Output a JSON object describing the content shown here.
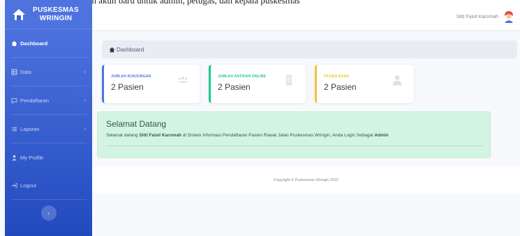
{
  "caption": "mlah akun baru untuk admin, petugas, dan kepala puskesmas",
  "sidebar": {
    "brand_line1": "PUSKESMAS",
    "brand_line2": "WRINGIN",
    "items": [
      {
        "label": "Dashboard",
        "icon": "home-icon",
        "active": true
      },
      {
        "label": "Data",
        "icon": "table-icon",
        "has_submenu": true
      },
      {
        "label": "Pendaftaran",
        "icon": "comment-icon",
        "has_submenu": true
      },
      {
        "label": "Laporan",
        "icon": "list-icon",
        "has_submenu": true
      },
      {
        "label": "My Profile",
        "icon": "user-icon"
      },
      {
        "label": "Logout",
        "icon": "logout-icon"
      }
    ],
    "toggle_glyph": "‹"
  },
  "topbar": {
    "user_name": "Sitti Faisil Karomah"
  },
  "breadcrumb": {
    "label": "Dashboard"
  },
  "cards": [
    {
      "label": "JUMLAH KUNJUNGAN",
      "value": "2 Pasien",
      "icon": "users-icon",
      "accent": "#4e73df"
    },
    {
      "label": "JUMLAH ANTRIAN ONLINE",
      "value": "2 Pasien",
      "icon": "mobile-icon",
      "accent": "#1cc88a"
    },
    {
      "label": "PASIEN BARU",
      "value": "2 Pasien",
      "icon": "user-icon",
      "accent": "#f6c23e"
    }
  ],
  "welcome": {
    "title": "Selamat Datang",
    "prefix": "Selamat datang ",
    "user": "Sitti Faisil Karomah",
    "middle": " di Sistem Informasi Pendaftaran Pasien Rawat Jalan Puskesmas Wringin, Anda Login Sebagai ",
    "role": "Admin"
  },
  "footer": {
    "copyright": "Copyright © Puskesmas Wringin 2022"
  },
  "colors": {
    "primary": "#4e73df",
    "success": "#1cc88a",
    "warning": "#f6c23e",
    "welcome_bg": "#d4f4e3"
  }
}
